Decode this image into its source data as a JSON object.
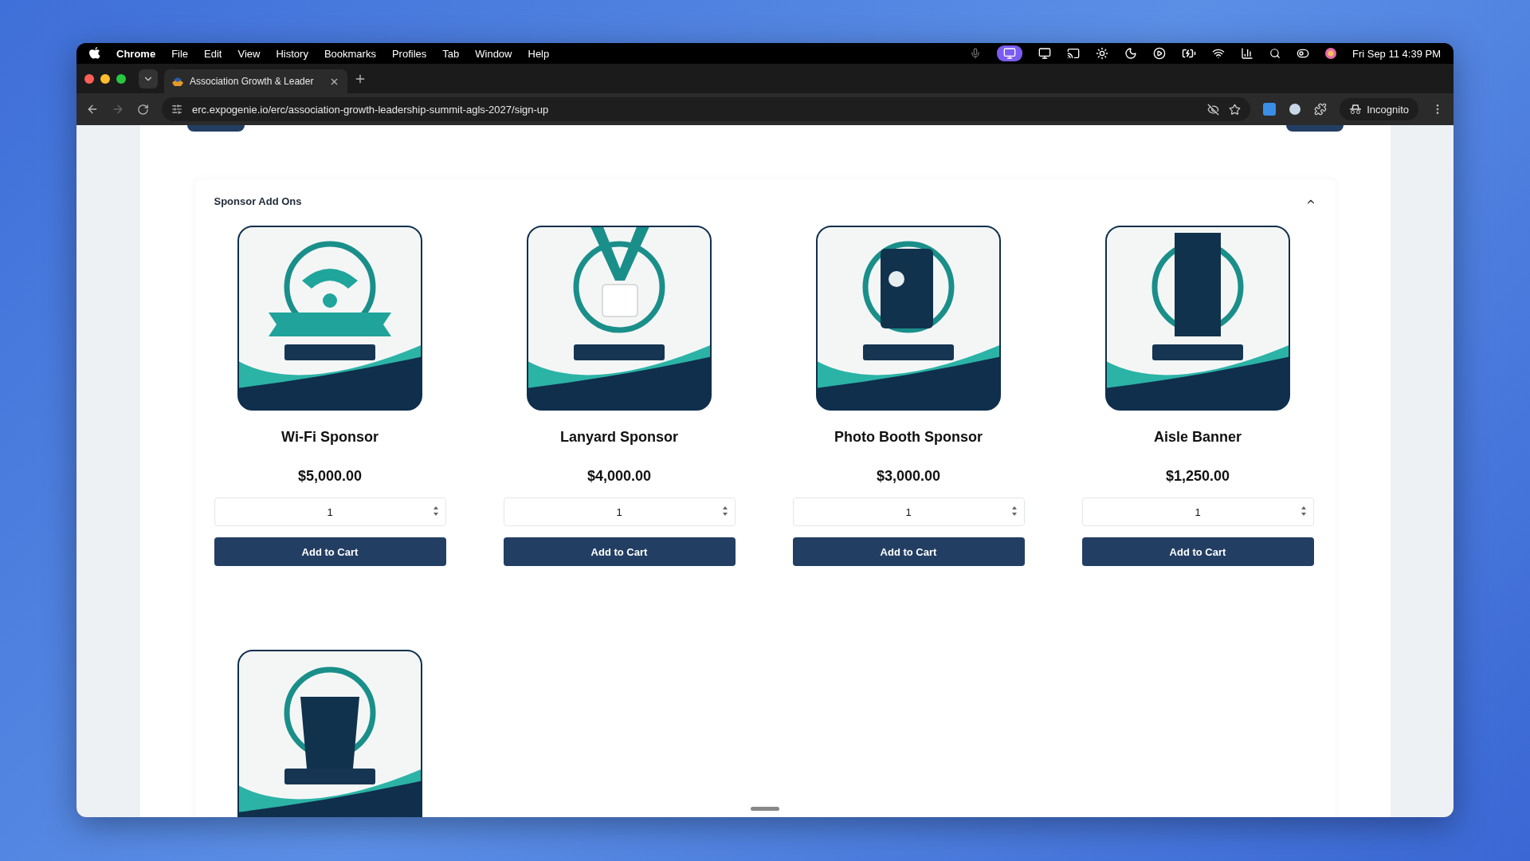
{
  "menu_bar": {
    "app": "Chrome",
    "items": [
      "File",
      "Edit",
      "View",
      "History",
      "Bookmarks",
      "Profiles",
      "Tab",
      "Window",
      "Help"
    ],
    "clock": "Fri Sep 11  4:39 PM"
  },
  "browser": {
    "tabs": [
      {
        "title": "Association Growth & Leader",
        "selected": true
      }
    ],
    "url": "erc.expogenie.io/erc/association-growth-leadership-summit-agls-2027/sign-up",
    "profile": "Incognito"
  },
  "section": {
    "title": "Sponsor Add Ons",
    "expanded": true,
    "products": [
      {
        "image": {
          "kind": "picture"
        },
        "name": "Wi-Fi Sponsor",
        "price": "$5,000.00",
        "quantity": "1",
        "button": "Add to Cart"
      },
      {
        "image": {
          "kind": "picture"
        },
        "name": "Lanyard Sponsor",
        "price": "$4,000.00",
        "quantity": "1",
        "button": "Add to Cart"
      },
      {
        "image": {
          "kind": "picture"
        },
        "name": "Photo Booth Sponsor",
        "price": "$3,000.00",
        "quantity": "1",
        "button": "Add to Cart"
      },
      {
        "image": {
          "kind": "picture"
        },
        "name": "Aisle Banner",
        "price": "$1,250.00",
        "quantity": "1",
        "button": "Add to Cart"
      },
      {
        "image": {
          "kind": "picture"
        }
      }
    ]
  }
}
